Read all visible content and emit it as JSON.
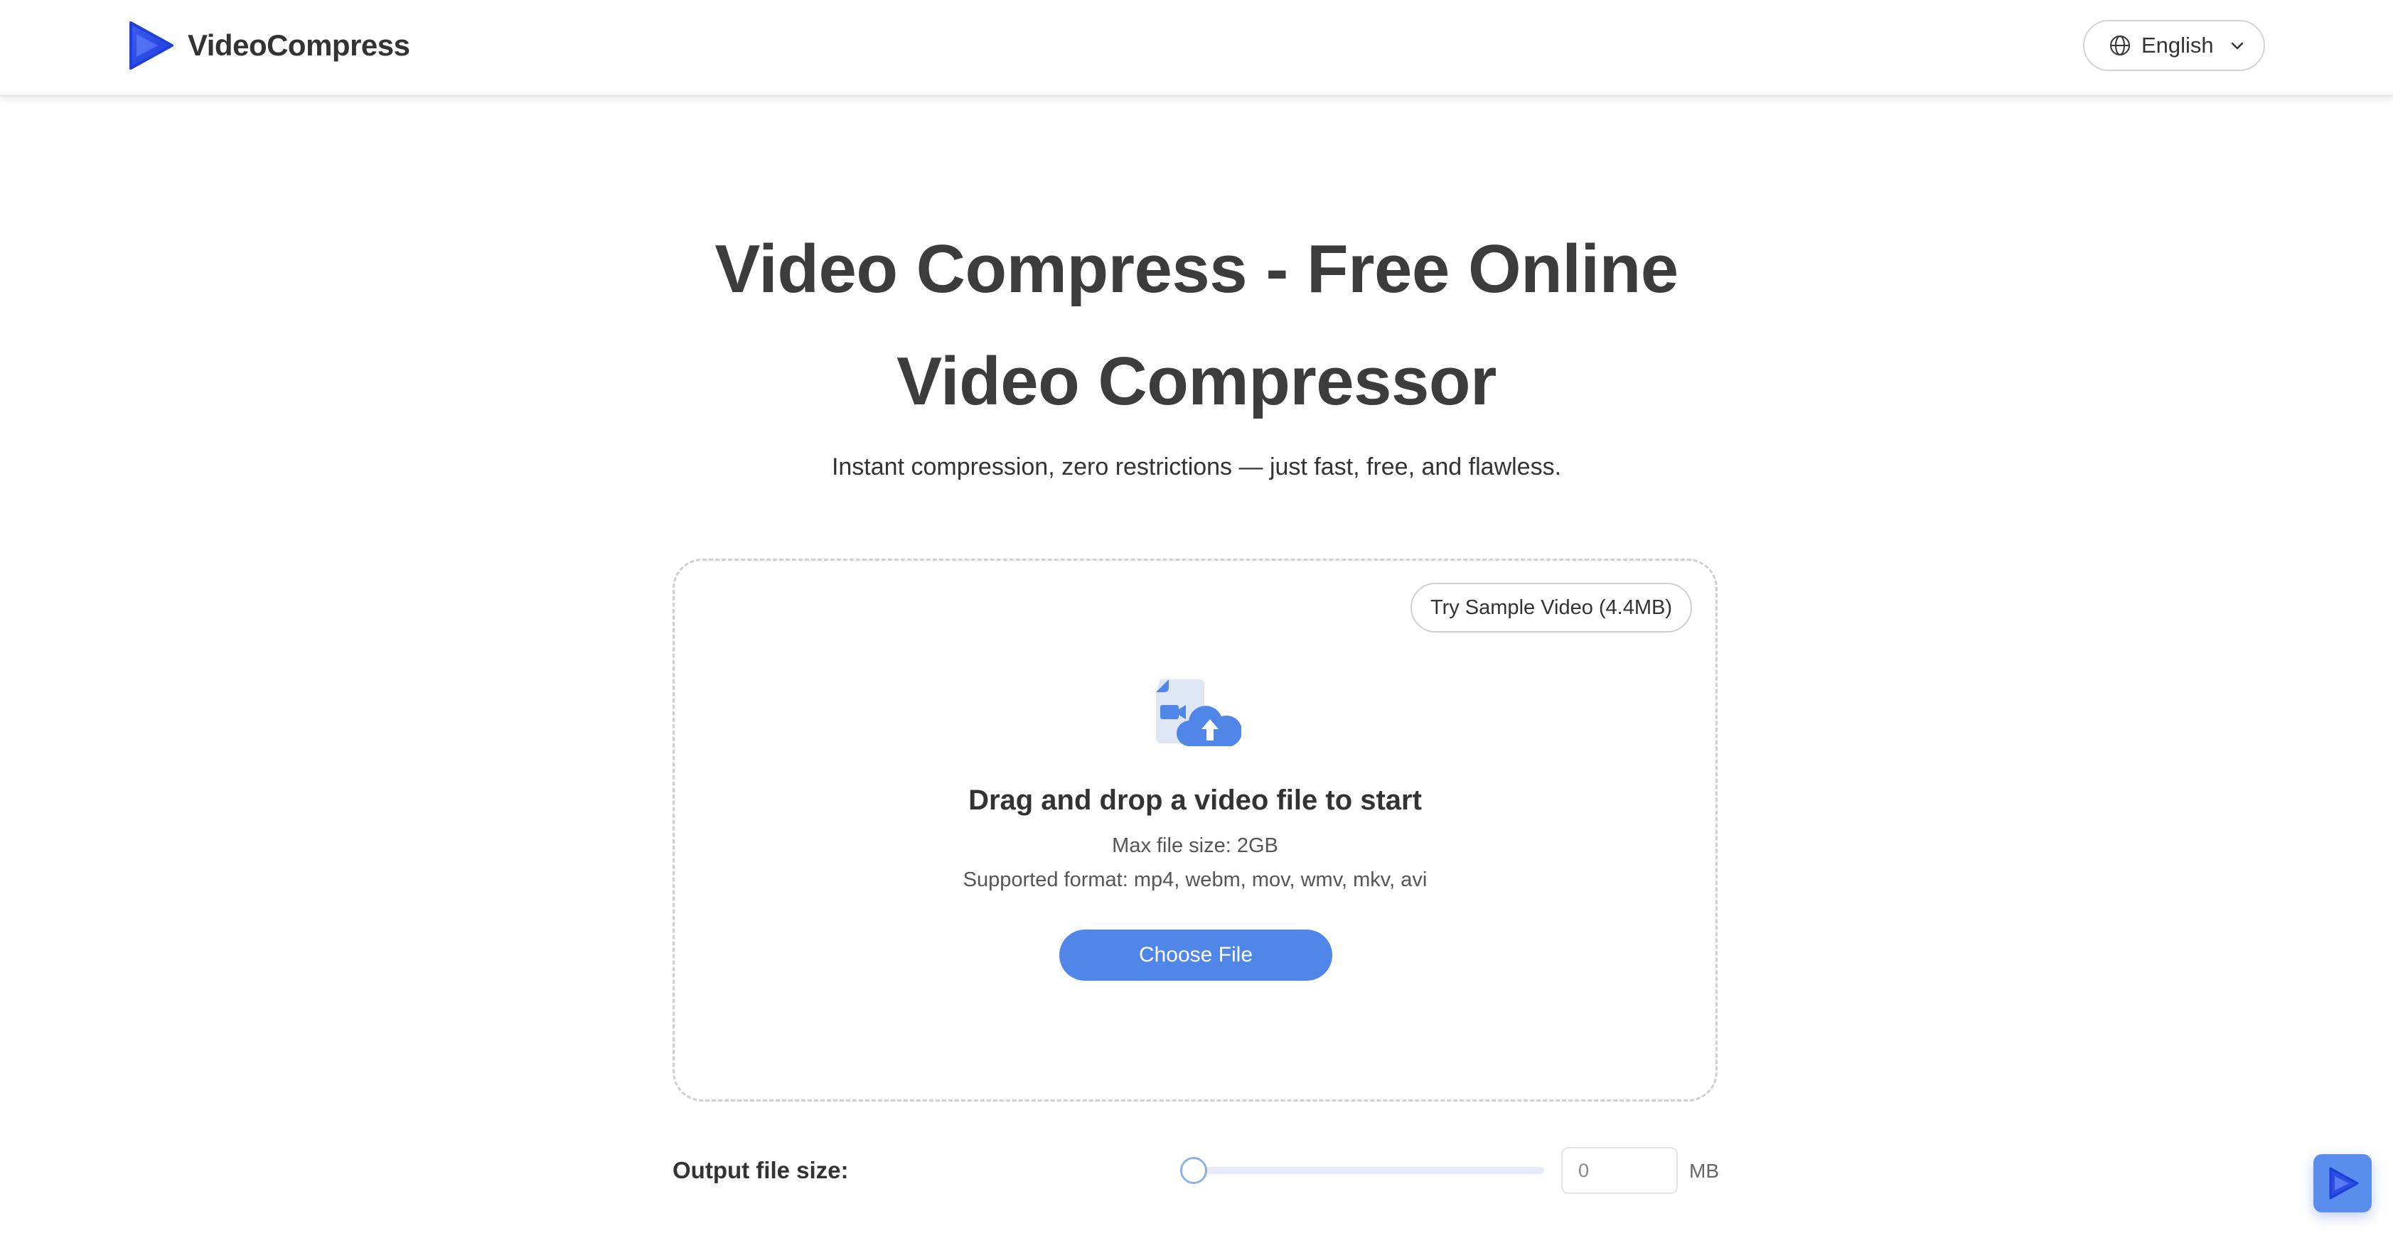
{
  "header": {
    "brand_name": "VideoCompress",
    "language": "English"
  },
  "hero": {
    "title_line1": "Video Compress - Free Online",
    "title_line2": "Video Compressor",
    "subtitle": "Instant compression, zero restrictions — just fast, free, and flawless."
  },
  "dropzone": {
    "sample_button": "Try Sample Video (4.4MB)",
    "title": "Drag and drop a video file to start",
    "max_size": "Max file size: 2GB",
    "formats": "Supported format: mp4, webm, mov, wmv, mkv, avi",
    "choose_button": "Choose File"
  },
  "output": {
    "label": "Output file size:",
    "value": "0",
    "unit": "MB",
    "slider_fraction": 0
  },
  "colors": {
    "accent": "#4f86e8",
    "brand_blue": "#2f5de8"
  },
  "icons": [
    "play-logo-icon",
    "globe-icon",
    "chevron-down-icon",
    "video-upload-icon",
    "play-icon"
  ]
}
